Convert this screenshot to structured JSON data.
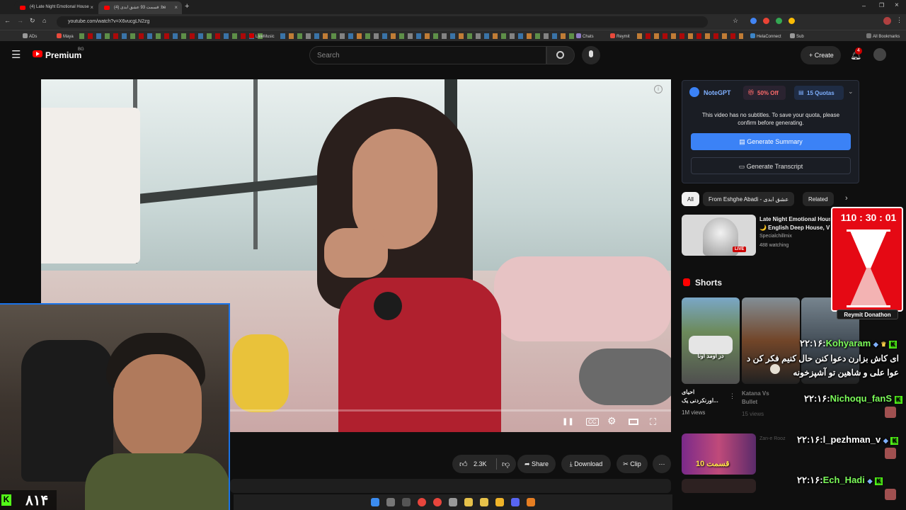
{
  "browser": {
    "tabs": [
      {
        "title": "(4) Late Night Emotional House",
        "active": false
      },
      {
        "title": "(4) قسمت 93 عشق ابدی :be",
        "active": true
      }
    ],
    "url": "youtube.com/watch?v=X6vucgLN2zg",
    "bookmarks": [
      "ADs",
      "Maya",
      "LiveMusic",
      "Chats",
      "Reymit",
      "HelaConnect",
      "Sub",
      "All Bookmarks"
    ]
  },
  "header": {
    "brand": "Premium",
    "country": "BG",
    "search_placeholder": "Search",
    "create_label": "Create",
    "notification_count": "4"
  },
  "video": {
    "controls": [
      "pause",
      "cc",
      "settings",
      "theater",
      "fullscreen"
    ]
  },
  "actions": {
    "like_count": "2.3K",
    "share": "Share",
    "download": "Download",
    "clip": "Clip"
  },
  "notegpt": {
    "brand": "NoteGPT",
    "discount": "50% Off",
    "quotas": "15 Quotas",
    "message": "This video has no subtitles. To save your quota, please confirm before generating.",
    "generate_summary": "Generate Summary",
    "generate_transcript": "Generate Transcript"
  },
  "chips": [
    "All",
    "From Eshghe Abadi - عشق ابدی",
    "Related"
  ],
  "related": {
    "title_line1": "Late Night Emotional House",
    "title_line2": "🌙 English Deep House, V",
    "channel": "Specialchillmix",
    "watching": "488 watching",
    "live": "LIVE"
  },
  "shorts": {
    "header": "Shorts",
    "items": [
      {
        "title_line1": "احیای",
        "title_line2": "اورنکردنی یک...",
        "views": "1M views",
        "overlay": "در اومد اونا"
      },
      {
        "title_line1": "Katana Vs",
        "title_line2": "Bullet",
        "views": "15 views"
      }
    ]
  },
  "playlist_item": {
    "title": "Zan-e Rooz",
    "label": "قسمت 10"
  },
  "timer": {
    "time": "110 : 30 : 01",
    "label": "Reymit Donathon"
  },
  "chat": [
    {
      "time": "۲۲:۱۶",
      "user": "Kohyaram",
      "color": "#7cfc5a",
      "message": "ای کاش بزارن دعوا کنن حال کنیم فکر کن د عوا علی و شاهین تو آشپزخونه"
    },
    {
      "time": "۲۲:۱۶",
      "user": "Nichoqu_fanS",
      "color": "#7cfc5a",
      "message": ""
    },
    {
      "time": "۲۲:۱۶",
      "user": "l_pezhman_v",
      "color": "#ffffff",
      "message": ""
    },
    {
      "time": "۲۲:۱۶",
      "user": "Ech_Hadi",
      "color": "#7cfc5a",
      "message": ""
    }
  ],
  "webcam": {
    "counter": "۸۱۴",
    "kick_label": "K"
  }
}
